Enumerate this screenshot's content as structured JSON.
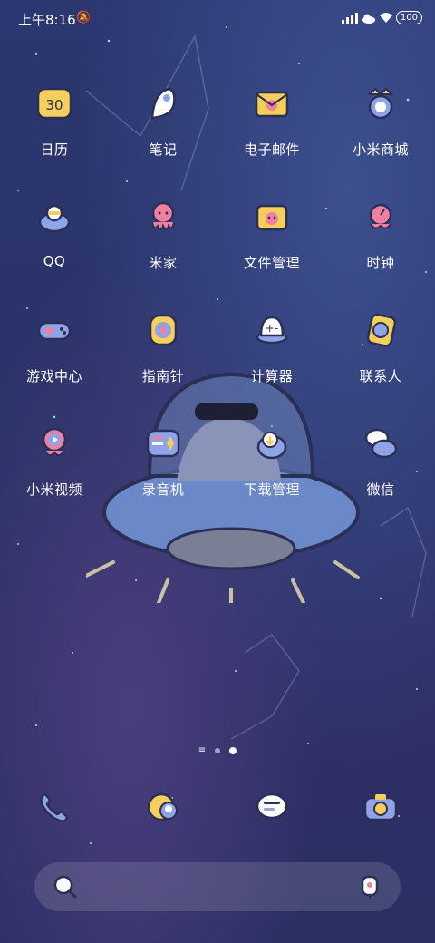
{
  "status_bar": {
    "time": "上午8:16",
    "mute_icon": "bell-off-icon",
    "signal_icon": "signal-icon",
    "cloud_icon": "cloud-icon",
    "wifi_icon": "wifi-icon",
    "battery": "100"
  },
  "apps": [
    {
      "label": "日历",
      "icon": "calendar-icon",
      "day": "30"
    },
    {
      "label": "笔记",
      "icon": "notes-icon"
    },
    {
      "label": "电子邮件",
      "icon": "email-icon"
    },
    {
      "label": "小米商城",
      "icon": "mi-store-icon"
    },
    {
      "label": "QQ",
      "icon": "qq-icon"
    },
    {
      "label": "米家",
      "icon": "mijia-icon"
    },
    {
      "label": "文件管理",
      "icon": "file-manager-icon"
    },
    {
      "label": "时钟",
      "icon": "clock-icon"
    },
    {
      "label": "游戏中心",
      "icon": "game-center-icon"
    },
    {
      "label": "指南针",
      "icon": "compass-icon"
    },
    {
      "label": "计算器",
      "icon": "calculator-icon"
    },
    {
      "label": "联系人",
      "icon": "contacts-icon"
    },
    {
      "label": "小米视频",
      "icon": "mi-video-icon"
    },
    {
      "label": "录音机",
      "icon": "recorder-icon"
    },
    {
      "label": "下载管理",
      "icon": "download-manager-icon"
    },
    {
      "label": "微信",
      "icon": "wechat-icon"
    }
  ],
  "dock": [
    {
      "icon": "phone-icon"
    },
    {
      "icon": "browser-icon"
    },
    {
      "icon": "messages-icon"
    },
    {
      "icon": "camera-icon"
    }
  ],
  "page_indicator": {
    "pages": 2,
    "current": 2
  },
  "search_bar": {
    "left_icon": "search-icon",
    "right_icon": "assistant-icon"
  },
  "colors": {
    "icon_yellow": "#f5cf5a",
    "icon_pink": "#f07fa0",
    "icon_blue": "#8fa3e8",
    "ufo_blue": "#6b88c9"
  }
}
